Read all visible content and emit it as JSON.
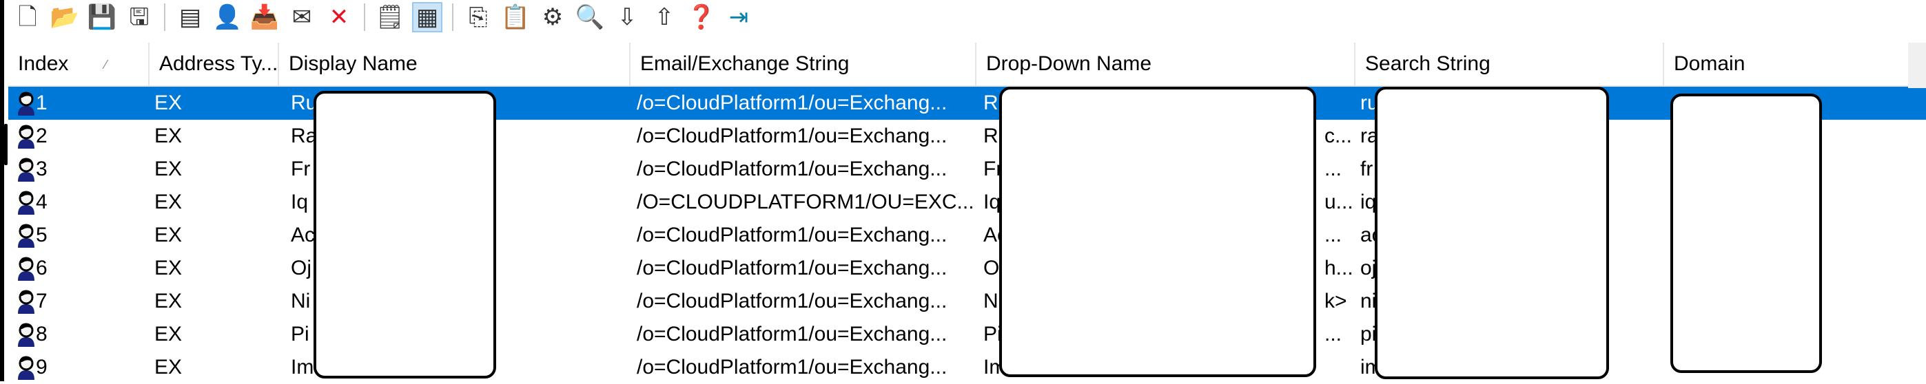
{
  "toolbar": {
    "buttons": [
      {
        "name": "new-icon",
        "glyph": "🗋"
      },
      {
        "name": "open-folder-icon",
        "glyph": "📂"
      },
      {
        "name": "save-icon",
        "glyph": "💾"
      },
      {
        "name": "save-export-icon",
        "glyph": "🖫"
      },
      {
        "name": "sep"
      },
      {
        "name": "properties-icon",
        "glyph": "▤"
      },
      {
        "name": "add-user-icon",
        "glyph": "👤"
      },
      {
        "name": "import-icon",
        "glyph": "📥"
      },
      {
        "name": "mail-add-icon",
        "glyph": "✉"
      },
      {
        "name": "delete-icon",
        "glyph": "✕",
        "color": "#e81123"
      },
      {
        "name": "sep"
      },
      {
        "name": "details-view-icon",
        "glyph": "🗒"
      },
      {
        "name": "grid-view-icon",
        "glyph": "▦",
        "active": true
      },
      {
        "name": "sep"
      },
      {
        "name": "copy-icon",
        "glyph": "⎘"
      },
      {
        "name": "paste-icon",
        "glyph": "📋"
      },
      {
        "name": "settings-icon",
        "glyph": "⚙"
      },
      {
        "name": "find-icon",
        "glyph": "🔍"
      },
      {
        "name": "arrow-down-icon",
        "glyph": "⇩"
      },
      {
        "name": "arrow-up-icon",
        "glyph": "⇧"
      },
      {
        "name": "help-icon",
        "glyph": "❓"
      },
      {
        "name": "exit-icon",
        "glyph": "⇥",
        "color": "#0a7fa8"
      }
    ]
  },
  "columns": [
    {
      "key": "index",
      "label": "Index",
      "sorted": true
    },
    {
      "key": "type",
      "label": "Address Ty..."
    },
    {
      "key": "display",
      "label": "Display Name"
    },
    {
      "key": "email",
      "label": "Email/Exchange String"
    },
    {
      "key": "dropdown",
      "label": "Drop-Down Name"
    },
    {
      "key": "search",
      "label": "Search String"
    },
    {
      "key": "domain",
      "label": "Domain"
    }
  ],
  "rows": [
    {
      "index": "1",
      "type": "EX",
      "display": "Ru",
      "email": "/o=CloudPlatform1/ou=Exchang...",
      "dropdown": "Ru",
      "dd_tail": "",
      "search": "ru",
      "selected": true
    },
    {
      "index": "2",
      "type": "EX",
      "display": "Ra",
      "email": "/o=CloudPlatform1/ou=Exchang...",
      "dropdown": "Ra",
      "dd_tail": "c...",
      "search": "ra"
    },
    {
      "index": "3",
      "type": "EX",
      "display": "Fr",
      "email": "/o=CloudPlatform1/ou=Exchang...",
      "dropdown": "Fr",
      "dd_tail": "...",
      "search": "fr"
    },
    {
      "index": "4",
      "type": "EX",
      "display": "Iq",
      "email": "/O=CLOUDPLATFORM1/OU=EXC...",
      "dropdown": "Iq",
      "dd_tail": "u...",
      "search": "iq"
    },
    {
      "index": "5",
      "type": "EX",
      "display": "Ac",
      "email": "/o=CloudPlatform1/ou=Exchang...",
      "dropdown": "Ac",
      "dd_tail": "...",
      "search": "ac"
    },
    {
      "index": "6",
      "type": "EX",
      "display": "Oj",
      "email": "/o=CloudPlatform1/ou=Exchang...",
      "dropdown": "O",
      "dd_tail": "h...",
      "search": "oj"
    },
    {
      "index": "7",
      "type": "EX",
      "display": "Ni",
      "email": "/o=CloudPlatform1/ou=Exchang...",
      "dropdown": "Ni",
      "dd_tail": "k>",
      "search": "ni"
    },
    {
      "index": "8",
      "type": "EX",
      "display": "Pi",
      "email": "/o=CloudPlatform1/ou=Exchang...",
      "dropdown": "Pi",
      "dd_tail": "...",
      "search": "pi"
    },
    {
      "index": "9",
      "type": "EX",
      "display": "Im",
      "email": "/o=CloudPlatform1/ou=Exchang...",
      "dropdown": "Im",
      "dd_tail": "",
      "search": "im"
    }
  ],
  "colors": {
    "selection": "#0078d7",
    "header_border": "#e5e5e5"
  }
}
